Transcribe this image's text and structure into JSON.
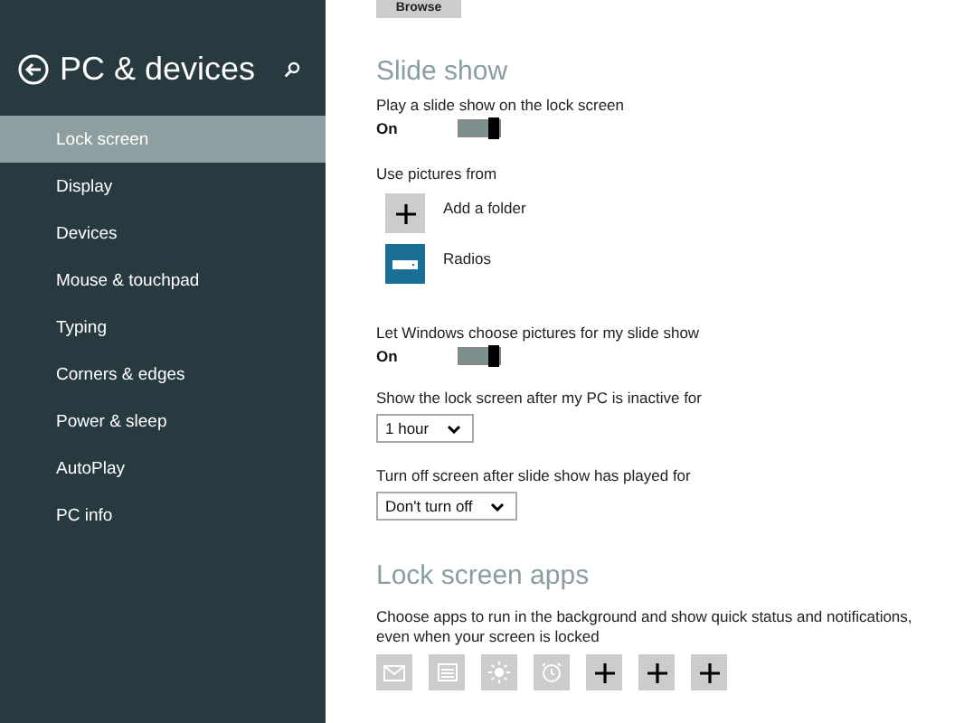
{
  "sidebar": {
    "title": "PC & devices",
    "items": [
      {
        "label": "Lock screen",
        "selected": true
      },
      {
        "label": "Display",
        "selected": false
      },
      {
        "label": "Devices",
        "selected": false
      },
      {
        "label": "Mouse & touchpad",
        "selected": false
      },
      {
        "label": "Typing",
        "selected": false
      },
      {
        "label": "Corners & edges",
        "selected": false
      },
      {
        "label": "Power & sleep",
        "selected": false
      },
      {
        "label": "AutoPlay",
        "selected": false
      },
      {
        "label": "PC info",
        "selected": false
      }
    ]
  },
  "main": {
    "browse_button": "Browse",
    "slide_show": {
      "heading": "Slide show",
      "play_toggle": {
        "label": "Play a slide show on the lock screen",
        "state_text": "On",
        "on": true
      },
      "pictures_label": "Use pictures from",
      "sources": [
        {
          "kind": "add",
          "label": "Add a folder"
        },
        {
          "kind": "folder",
          "label": "Radios"
        }
      ],
      "choose_toggle": {
        "label": "Let Windows choose pictures for my slide show",
        "state_text": "On",
        "on": true
      },
      "inactive": {
        "label": "Show the lock screen after my PC is inactive for",
        "value": "1 hour"
      },
      "turn_off": {
        "label": "Turn off screen after slide show has played for",
        "value": "Don't turn off"
      }
    },
    "lock_screen_apps": {
      "heading": "Lock screen apps",
      "description": "Choose apps to run in the background and show quick status and notifications, even when your screen is locked",
      "slots": [
        {
          "kind": "mail"
        },
        {
          "kind": "calendar"
        },
        {
          "kind": "weather"
        },
        {
          "kind": "alarm"
        },
        {
          "kind": "add"
        },
        {
          "kind": "add"
        },
        {
          "kind": "add"
        }
      ]
    }
  }
}
